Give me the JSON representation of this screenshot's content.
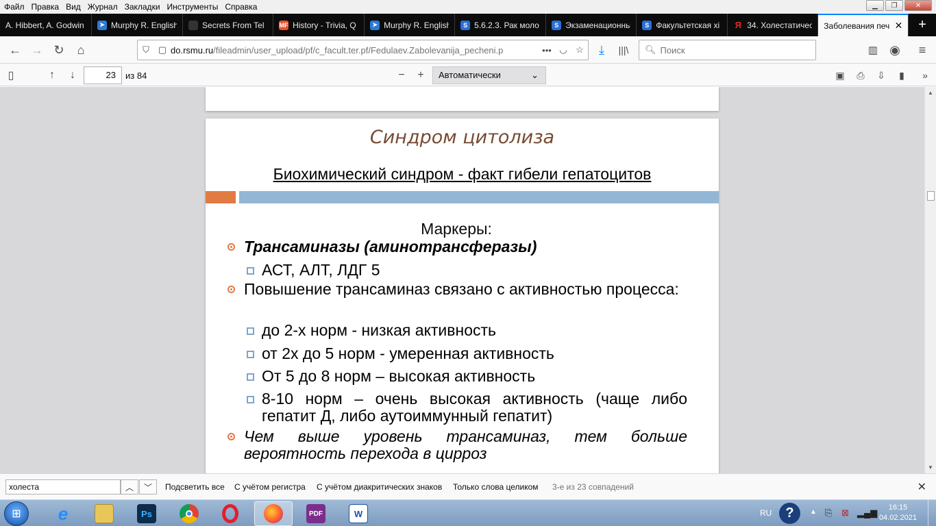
{
  "menu": [
    "Файл",
    "Правка",
    "Вид",
    "Журнал",
    "Закладки",
    "Инструменты",
    "Справка"
  ],
  "tabs": [
    {
      "label": "A. Hibbert, A. Godwin",
      "icon": "doc-icon",
      "color": "#0c0c0d"
    },
    {
      "label": "Murphy R. English",
      "icon": "bird-icon",
      "color": "#2b7bd6"
    },
    {
      "label": "Secrets From Tel",
      "icon": "dark-icon",
      "color": "#333333"
    },
    {
      "label": "History - Trivia, Q",
      "icon": "mf-icon",
      "color": "#e8502a"
    },
    {
      "label": "Murphy R. English",
      "icon": "bird-icon",
      "color": "#2b7bd6"
    },
    {
      "label": "5.6.2.3. Рак моло",
      "icon": "s-icon",
      "color": "#2a6fd6"
    },
    {
      "label": "Экзаменационны",
      "icon": "s-icon",
      "color": "#2a6fd6"
    },
    {
      "label": "Факультетская хі",
      "icon": "s-icon",
      "color": "#2a6fd6"
    },
    {
      "label": "34. Холестатичес",
      "icon": "yandex-icon",
      "color": "#e02a2a"
    },
    {
      "label": "Заболевания печ",
      "icon": "pdf-icon",
      "color": "#f9f9fa",
      "active": true
    }
  ],
  "nav": {
    "url_domain": "do.rsmu.ru",
    "url_path": "/fileadmin/user_upload/pf/c_facult.ter.pf/Fedulaev.Zabolevanija_pecheni.p",
    "search_placeholder": "Поиск"
  },
  "pdf_toolbar": {
    "page_number": "23",
    "page_total": "из 84",
    "zoom": "Автоматически"
  },
  "slide": {
    "title": "Синдром цитолиза",
    "subtitle": "Биохимический синдром -  факт гибели гепатоцитов",
    "markers": "Маркеры:",
    "b1_trans": "Трансаминазы (аминотрансферазы)",
    "b2_ast": "АСТ, АЛТ, ЛДГ 5",
    "b1_rise": "Повышение трансаминаз связано с активностью процесса:",
    "b2_low": "до 2-х норм - низкая активность",
    "b2_mod": "от 2х до 5 норм - умеренная активность",
    "b2_high": "От 5 до 8 норм – высокая активность",
    "b2_vhigh": "8-10 норм – очень высокая активность (чаще либо гепатит Д, либо аутоиммунный гепатит)",
    "b1_cirr": "Чем выше уровень трансаминаз, тем больше вероятность перехода в цирроз",
    "colors": {
      "title": "#774a33",
      "orange": "#e07b43",
      "blue": "#93b6d5"
    }
  },
  "findbar": {
    "query": "холеста",
    "highlight_all": "Подсветить все",
    "match_case": "С учётом регистра",
    "match_diacritics": "С учётом диакритических знаков",
    "whole_words": "Только слова целиком",
    "status": "3-е из 23 совпадений"
  },
  "taskbar": {
    "lang": "RU",
    "time": "16:15",
    "date": "04.02.2021"
  }
}
